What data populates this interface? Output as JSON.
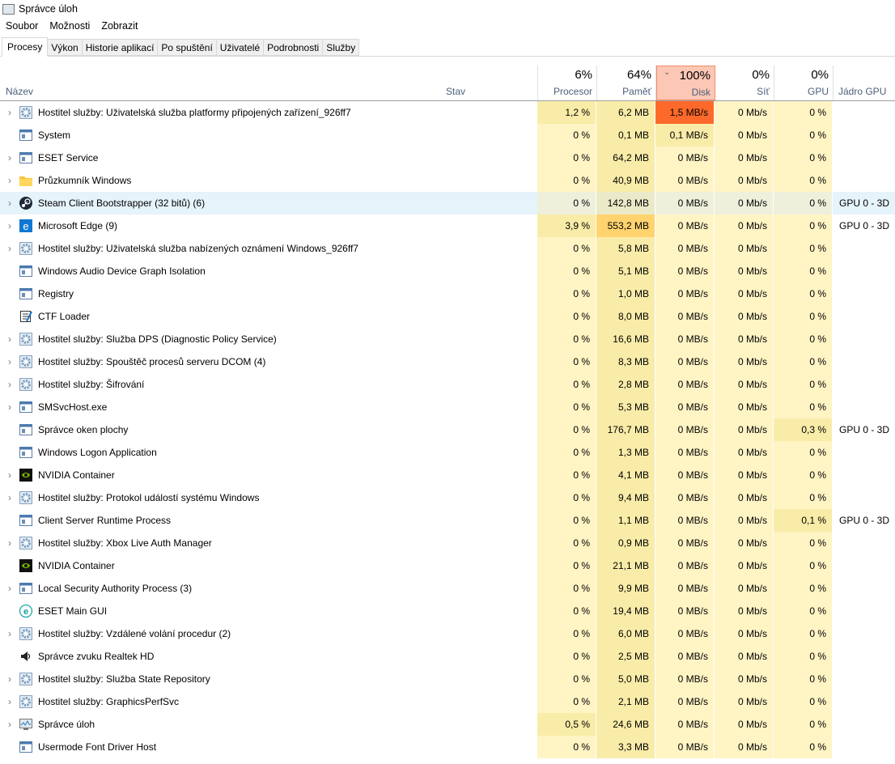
{
  "window": {
    "title": "Správce úloh"
  },
  "menu": [
    "Soubor",
    "Možnosti",
    "Zobrazit"
  ],
  "tabs": [
    "Procesy",
    "Výkon",
    "Historie aplikací",
    "Po spuštění",
    "Uživatelé",
    "Podrobnosti",
    "Služby"
  ],
  "columns": {
    "name": "Název",
    "status": "Stav",
    "cpu": {
      "label": "Procesor",
      "total": "6%"
    },
    "mem": {
      "label": "Paměť",
      "total": "64%"
    },
    "disk": {
      "label": "Disk",
      "total": "100%"
    },
    "net": {
      "label": "Síť",
      "total": "0%"
    },
    "gpu": {
      "label": "GPU",
      "total": "0%"
    },
    "engine": "Jádro GPU"
  },
  "colors": {
    "sorted_header": "#fcc7b4",
    "disk_hot": "#fd692a",
    "cell_light": "#fff4c4",
    "cell_mid": "#f9eca8",
    "hover": "#e5f3fb"
  },
  "rows": [
    {
      "name": "Hostitel služby: Uživatelská služba platformy připojených zařízení_926ff7",
      "icon": "gear-icon",
      "exp": true,
      "cpu": "1,2 %",
      "mem": "6,2 MB",
      "disk": "1,5 MB/s",
      "net": "0 Mb/s",
      "gpu": "0 %",
      "engine": "",
      "h": [
        1,
        1,
        9,
        0,
        0
      ]
    },
    {
      "name": "System",
      "icon": "window-icon",
      "exp": false,
      "cpu": "0 %",
      "mem": "0,1 MB",
      "disk": "0,1 MB/s",
      "net": "0 Mb/s",
      "gpu": "0 %",
      "engine": "",
      "h": [
        0,
        1,
        1,
        0,
        0
      ]
    },
    {
      "name": "ESET Service",
      "icon": "window-icon",
      "exp": true,
      "cpu": "0 %",
      "mem": "64,2 MB",
      "disk": "0 MB/s",
      "net": "0 Mb/s",
      "gpu": "0 %",
      "engine": "",
      "h": [
        0,
        1,
        0,
        0,
        0
      ]
    },
    {
      "name": "Průzkumník Windows",
      "icon": "folder-icon",
      "exp": true,
      "cpu": "0 %",
      "mem": "40,9 MB",
      "disk": "0 MB/s",
      "net": "0 Mb/s",
      "gpu": "0 %",
      "engine": "",
      "h": [
        0,
        1,
        0,
        0,
        0
      ]
    },
    {
      "name": "Steam Client Bootstrapper (32 bitů) (6)",
      "icon": "steam-icon",
      "exp": true,
      "cpu": "0 %",
      "mem": "142,8 MB",
      "disk": "0 MB/s",
      "net": "0 Mb/s",
      "gpu": "0 %",
      "engine": "GPU 0 - 3D",
      "h": [
        0,
        1,
        0,
        0,
        0
      ],
      "hover": true
    },
    {
      "name": "Microsoft Edge (9)",
      "icon": "edge-icon",
      "exp": true,
      "cpu": "3,9 %",
      "mem": "553,2 MB",
      "disk": "0 MB/s",
      "net": "0 Mb/s",
      "gpu": "0 %",
      "engine": "GPU 0 - 3D",
      "h": [
        1,
        3,
        0,
        0,
        0
      ]
    },
    {
      "name": "Hostitel služby: Uživatelská služba nabízených oznámení Windows_926ff7",
      "icon": "gear-icon",
      "exp": true,
      "cpu": "0 %",
      "mem": "5,8 MB",
      "disk": "0 MB/s",
      "net": "0 Mb/s",
      "gpu": "0 %",
      "engine": "",
      "h": [
        0,
        1,
        0,
        0,
        0
      ]
    },
    {
      "name": "Windows Audio Device Graph Isolation",
      "icon": "window-icon",
      "exp": false,
      "cpu": "0 %",
      "mem": "5,1 MB",
      "disk": "0 MB/s",
      "net": "0 Mb/s",
      "gpu": "0 %",
      "engine": "",
      "h": [
        0,
        1,
        0,
        0,
        0
      ]
    },
    {
      "name": "Registry",
      "icon": "window-icon",
      "exp": false,
      "cpu": "0 %",
      "mem": "1,0 MB",
      "disk": "0 MB/s",
      "net": "0 Mb/s",
      "gpu": "0 %",
      "engine": "",
      "h": [
        0,
        1,
        0,
        0,
        0
      ]
    },
    {
      "name": "CTF Loader",
      "icon": "ctf-icon",
      "exp": false,
      "cpu": "0 %",
      "mem": "8,0 MB",
      "disk": "0 MB/s",
      "net": "0 Mb/s",
      "gpu": "0 %",
      "engine": "",
      "h": [
        0,
        1,
        0,
        0,
        0
      ]
    },
    {
      "name": "Hostitel služby: Služba DPS (Diagnostic Policy Service)",
      "icon": "gear-icon",
      "exp": true,
      "cpu": "0 %",
      "mem": "16,6 MB",
      "disk": "0 MB/s",
      "net": "0 Mb/s",
      "gpu": "0 %",
      "engine": "",
      "h": [
        0,
        1,
        0,
        0,
        0
      ]
    },
    {
      "name": "Hostitel služby: Spouštěč procesů serveru DCOM (4)",
      "icon": "gear-icon",
      "exp": true,
      "cpu": "0 %",
      "mem": "8,3 MB",
      "disk": "0 MB/s",
      "net": "0 Mb/s",
      "gpu": "0 %",
      "engine": "",
      "h": [
        0,
        1,
        0,
        0,
        0
      ]
    },
    {
      "name": "Hostitel služby: Šifrování",
      "icon": "gear-icon",
      "exp": true,
      "cpu": "0 %",
      "mem": "2,8 MB",
      "disk": "0 MB/s",
      "net": "0 Mb/s",
      "gpu": "0 %",
      "engine": "",
      "h": [
        0,
        1,
        0,
        0,
        0
      ]
    },
    {
      "name": "SMSvcHost.exe",
      "icon": "window-icon",
      "exp": true,
      "cpu": "0 %",
      "mem": "5,3 MB",
      "disk": "0 MB/s",
      "net": "0 Mb/s",
      "gpu": "0 %",
      "engine": "",
      "h": [
        0,
        1,
        0,
        0,
        0
      ]
    },
    {
      "name": "Správce oken plochy",
      "icon": "window-icon",
      "exp": false,
      "cpu": "0 %",
      "mem": "176,7 MB",
      "disk": "0 MB/s",
      "net": "0 Mb/s",
      "gpu": "0,3 %",
      "engine": "GPU 0 - 3D",
      "h": [
        0,
        1,
        0,
        0,
        1
      ]
    },
    {
      "name": "Windows Logon Application",
      "icon": "window-icon",
      "exp": false,
      "cpu": "0 %",
      "mem": "1,3 MB",
      "disk": "0 MB/s",
      "net": "0 Mb/s",
      "gpu": "0 %",
      "engine": "",
      "h": [
        0,
        1,
        0,
        0,
        0
      ]
    },
    {
      "name": "NVIDIA Container",
      "icon": "nvidia-icon",
      "exp": true,
      "cpu": "0 %",
      "mem": "4,1 MB",
      "disk": "0 MB/s",
      "net": "0 Mb/s",
      "gpu": "0 %",
      "engine": "",
      "h": [
        0,
        1,
        0,
        0,
        0
      ]
    },
    {
      "name": "Hostitel služby: Protokol událostí systému Windows",
      "icon": "gear-icon",
      "exp": true,
      "cpu": "0 %",
      "mem": "9,4 MB",
      "disk": "0 MB/s",
      "net": "0 Mb/s",
      "gpu": "0 %",
      "engine": "",
      "h": [
        0,
        1,
        0,
        0,
        0
      ]
    },
    {
      "name": "Client Server Runtime Process",
      "icon": "window-icon",
      "exp": false,
      "cpu": "0 %",
      "mem": "1,1 MB",
      "disk": "0 MB/s",
      "net": "0 Mb/s",
      "gpu": "0,1 %",
      "engine": "GPU 0 - 3D",
      "h": [
        0,
        1,
        0,
        0,
        1
      ]
    },
    {
      "name": "Hostitel služby: Xbox Live Auth Manager",
      "icon": "gear-icon",
      "exp": true,
      "cpu": "0 %",
      "mem": "0,9 MB",
      "disk": "0 MB/s",
      "net": "0 Mb/s",
      "gpu": "0 %",
      "engine": "",
      "h": [
        0,
        1,
        0,
        0,
        0
      ]
    },
    {
      "name": "NVIDIA Container",
      "icon": "nvidia-icon",
      "exp": false,
      "cpu": "0 %",
      "mem": "21,1 MB",
      "disk": "0 MB/s",
      "net": "0 Mb/s",
      "gpu": "0 %",
      "engine": "",
      "h": [
        0,
        1,
        0,
        0,
        0
      ]
    },
    {
      "name": "Local Security Authority Process (3)",
      "icon": "window-icon",
      "exp": true,
      "cpu": "0 %",
      "mem": "9,9 MB",
      "disk": "0 MB/s",
      "net": "0 Mb/s",
      "gpu": "0 %",
      "engine": "",
      "h": [
        0,
        1,
        0,
        0,
        0
      ]
    },
    {
      "name": "ESET Main GUI",
      "icon": "eset-icon",
      "exp": false,
      "cpu": "0 %",
      "mem": "19,4 MB",
      "disk": "0 MB/s",
      "net": "0 Mb/s",
      "gpu": "0 %",
      "engine": "",
      "h": [
        0,
        1,
        0,
        0,
        0
      ]
    },
    {
      "name": "Hostitel služby: Vzdálené volání procedur (2)",
      "icon": "gear-icon",
      "exp": true,
      "cpu": "0 %",
      "mem": "6,0 MB",
      "disk": "0 MB/s",
      "net": "0 Mb/s",
      "gpu": "0 %",
      "engine": "",
      "h": [
        0,
        1,
        0,
        0,
        0
      ]
    },
    {
      "name": "Správce zvuku Realtek HD",
      "icon": "speaker-icon",
      "exp": false,
      "cpu": "0 %",
      "mem": "2,5 MB",
      "disk": "0 MB/s",
      "net": "0 Mb/s",
      "gpu": "0 %",
      "engine": "",
      "h": [
        0,
        1,
        0,
        0,
        0
      ]
    },
    {
      "name": "Hostitel služby: Služba State Repository",
      "icon": "gear-icon",
      "exp": true,
      "cpu": "0 %",
      "mem": "5,0 MB",
      "disk": "0 MB/s",
      "net": "0 Mb/s",
      "gpu": "0 %",
      "engine": "",
      "h": [
        0,
        1,
        0,
        0,
        0
      ]
    },
    {
      "name": "Hostitel služby: GraphicsPerfSvc",
      "icon": "gear-icon",
      "exp": true,
      "cpu": "0 %",
      "mem": "2,1 MB",
      "disk": "0 MB/s",
      "net": "0 Mb/s",
      "gpu": "0 %",
      "engine": "",
      "h": [
        0,
        1,
        0,
        0,
        0
      ]
    },
    {
      "name": "Správce úloh",
      "icon": "taskmgr-icon",
      "exp": true,
      "cpu": "0,5 %",
      "mem": "24,6 MB",
      "disk": "0 MB/s",
      "net": "0 Mb/s",
      "gpu": "0 %",
      "engine": "",
      "h": [
        1,
        1,
        0,
        0,
        0
      ]
    },
    {
      "name": "Usermode Font Driver Host",
      "icon": "window-icon",
      "exp": false,
      "cpu": "0 %",
      "mem": "3,3 MB",
      "disk": "0 MB/s",
      "net": "0 Mb/s",
      "gpu": "0 %",
      "engine": "",
      "h": [
        0,
        1,
        0,
        0,
        0
      ]
    }
  ]
}
